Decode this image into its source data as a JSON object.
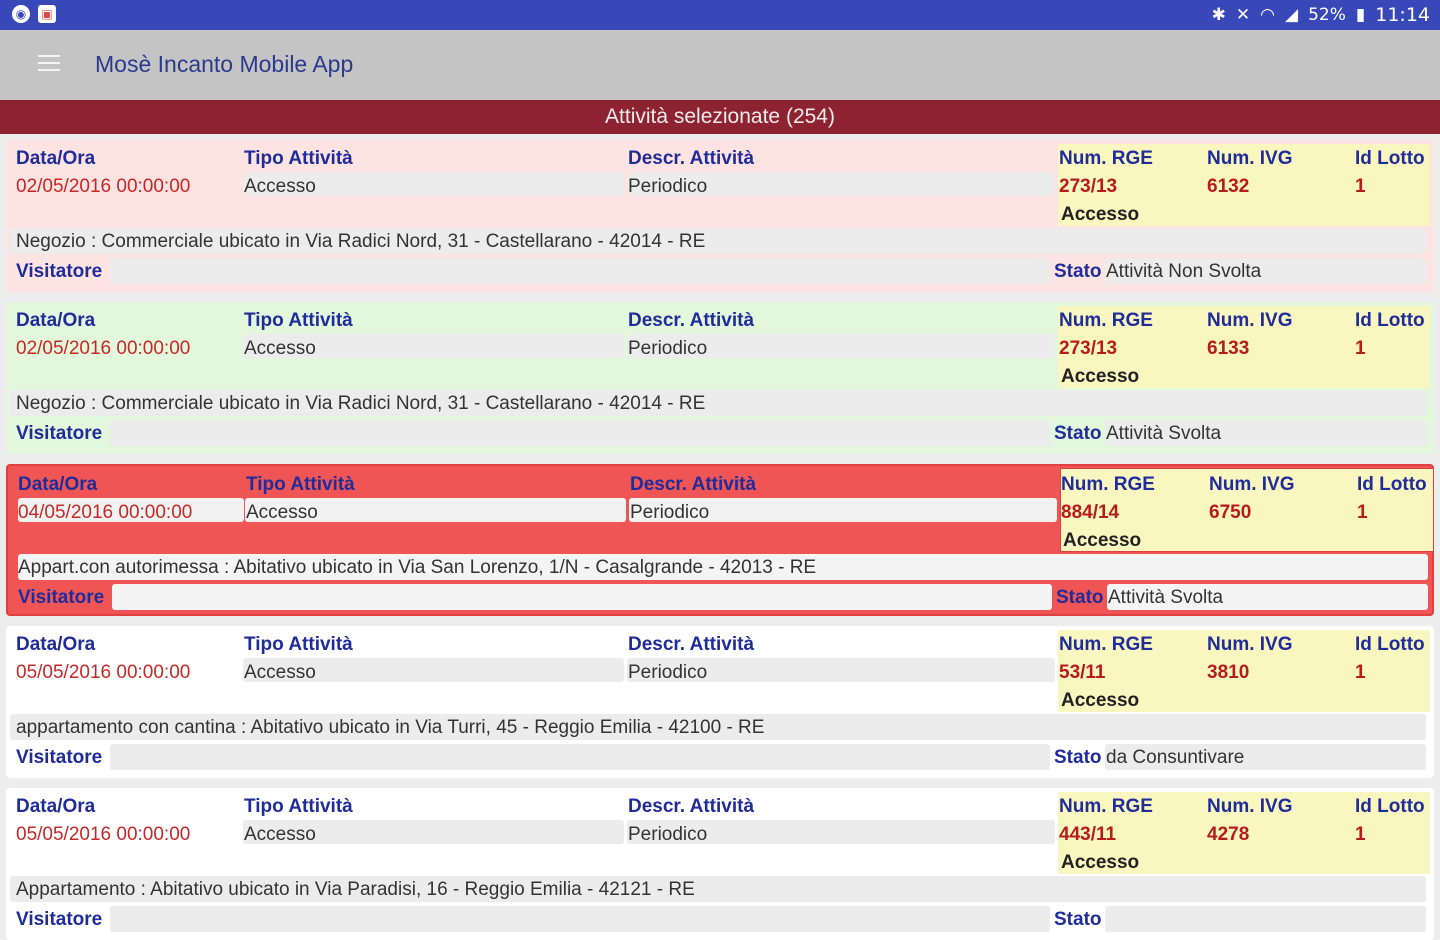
{
  "status_bar": {
    "left_icons": [
      "app-circle-icon",
      "image-notification-icon"
    ],
    "right_icons": [
      "bluetooth-icon",
      "mute-icon",
      "wifi-icon",
      "signal-icon",
      "battery-icon"
    ],
    "battery": "52%",
    "time": "11:14"
  },
  "app_bar": {
    "title": "Mosè Incanto Mobile App",
    "menu_icon": "hamburger-menu-icon"
  },
  "section": {
    "header": "Attività selezionate (254)"
  },
  "labels": {
    "data_ora": "Data/Ora",
    "tipo_attivita": "Tipo Attività",
    "descr_attivita": "Descr. Attività",
    "num_rge": "Num. RGE",
    "num_ivg": "Num. IVG",
    "id_lotto": "Id Lotto",
    "visitatore": "Visitatore",
    "stato": "Stato"
  },
  "colors": {
    "status_bar": "#3848b8",
    "app_bar": "#c4c4c4",
    "section_header": "#8d2330",
    "label_blue": "#1f2c99",
    "value_red": "#c62828",
    "card_pink": "#fde3e1",
    "card_green": "#e3f7dc",
    "card_red": "#f05555",
    "card_white": "#ffffff",
    "yellow": "#f9f6bf"
  },
  "cards": [
    {
      "variant": "pink",
      "data_ora": "02/05/2016 00:00:00",
      "tipo_attivita": "Accesso",
      "descr_attivita": "Periodico",
      "num_rge": "273/13",
      "rge_sub": "Accesso",
      "num_ivg": "6132",
      "id_lotto": "1",
      "descrizione": "Negozio : Commerciale ubicato in Via Radici Nord, 31 - Castellarano - 42014 - RE",
      "visitatore": "",
      "stato": "Attività Non Svolta"
    },
    {
      "variant": "green",
      "data_ora": "02/05/2016 00:00:00",
      "tipo_attivita": "Accesso",
      "descr_attivita": "Periodico",
      "num_rge": "273/13",
      "rge_sub": "Accesso",
      "num_ivg": "6133",
      "id_lotto": "1",
      "descrizione": "Negozio : Commerciale ubicato in Via Radici Nord, 31 - Castellarano - 42014 - RE",
      "visitatore": "",
      "stato": "Attività Svolta"
    },
    {
      "variant": "red",
      "data_ora": "04/05/2016 00:00:00",
      "tipo_attivita": "Accesso",
      "descr_attivita": "Periodico",
      "num_rge": "884/14",
      "rge_sub": "Accesso",
      "num_ivg": "6750",
      "id_lotto": "1",
      "descrizione": "Appart.con autorimessa : Abitativo ubicato in Via San Lorenzo, 1/N - Casalgrande - 42013 - RE",
      "visitatore": "",
      "stato": "Attività Svolta"
    },
    {
      "variant": "white",
      "data_ora": "05/05/2016 00:00:00",
      "tipo_attivita": "Accesso",
      "descr_attivita": "Periodico",
      "num_rge": "53/11",
      "rge_sub": "Accesso",
      "num_ivg": "3810",
      "id_lotto": "1",
      "descrizione": "appartamento con cantina : Abitativo ubicato in Via Turri, 45 - Reggio Emilia - 42100 - RE",
      "visitatore": "",
      "stato": "da Consuntivare"
    },
    {
      "variant": "white",
      "data_ora": "05/05/2016 00:00:00",
      "tipo_attivita": "Accesso",
      "descr_attivita": "Periodico",
      "num_rge": "443/11",
      "rge_sub": "Accesso",
      "num_ivg": "4278",
      "id_lotto": "1",
      "descrizione": "Appartamento : Abitativo ubicato in Via Paradisi, 16 - Reggio Emilia - 42121 - RE",
      "visitatore": "",
      "stato": ""
    }
  ]
}
